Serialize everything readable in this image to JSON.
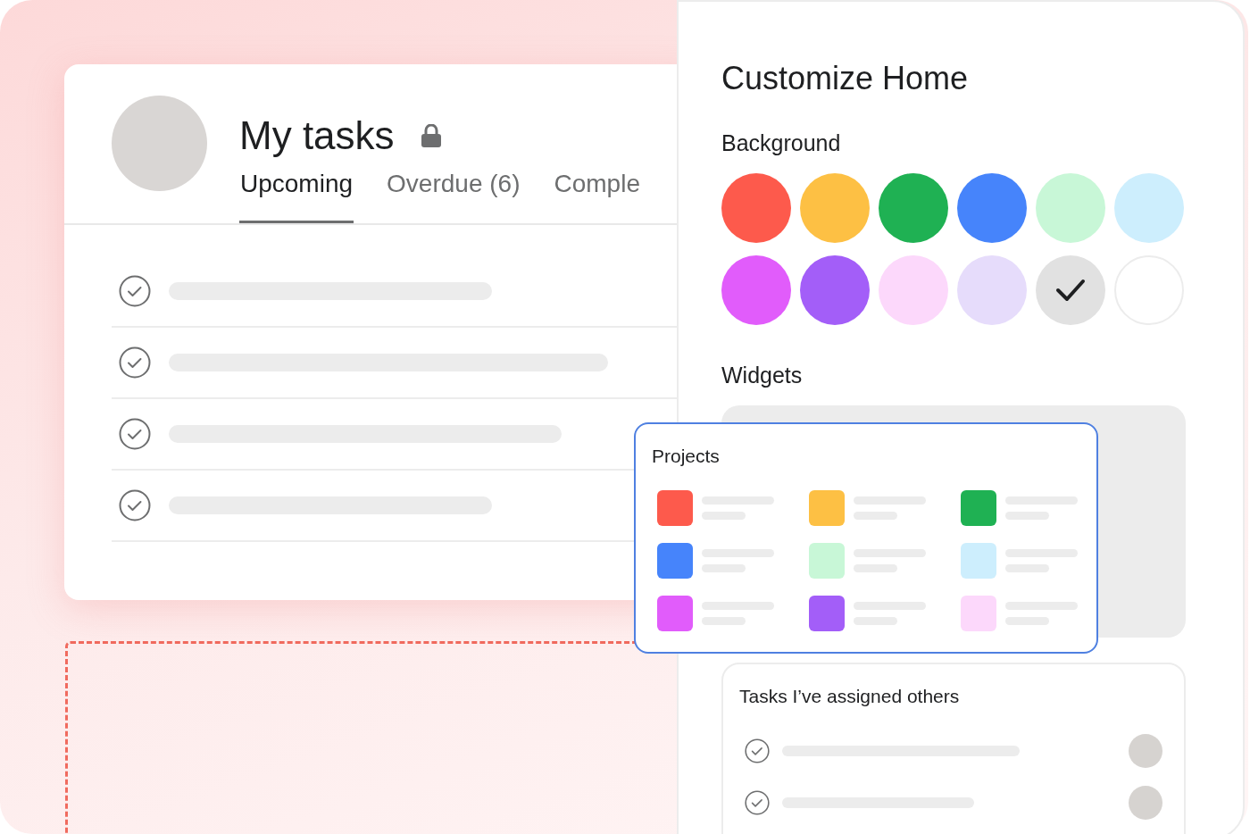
{
  "my_tasks": {
    "title": "My tasks",
    "locked": true,
    "tabs": [
      {
        "label": "Upcoming",
        "selected": true
      },
      {
        "label": "Overdue (6)",
        "selected": false
      },
      {
        "label": "Comple",
        "selected": false
      }
    ]
  },
  "customize": {
    "title": "Customize Home",
    "background": {
      "heading": "Background",
      "swatches": [
        {
          "color": "#fd5a4c",
          "selected": false
        },
        {
          "color": "#fdc044",
          "selected": false
        },
        {
          "color": "#1fb153",
          "selected": false
        },
        {
          "color": "#4684fb",
          "selected": false
        },
        {
          "color": "#c8f7d7",
          "selected": false
        },
        {
          "color": "#cdeefd",
          "selected": false
        },
        {
          "color": "#e15cfb",
          "selected": false
        },
        {
          "color": "#a35ef8",
          "selected": false
        },
        {
          "color": "#fcd8fb",
          "selected": false
        },
        {
          "color": "#e6dcfb",
          "selected": false
        },
        {
          "color": "#e1e1e1",
          "selected": true
        },
        {
          "color": "#ffffff",
          "selected": false
        }
      ]
    },
    "widgets": {
      "heading": "Widgets",
      "projects": {
        "title": "Projects",
        "items": [
          {
            "color": "#fd5a4c"
          },
          {
            "color": "#fdc044"
          },
          {
            "color": "#1fb153"
          },
          {
            "color": "#4684fb"
          },
          {
            "color": "#c8f7d7"
          },
          {
            "color": "#cdeefd"
          },
          {
            "color": "#e15cfb"
          },
          {
            "color": "#a35ef8"
          },
          {
            "color": "#fcd8fb"
          }
        ]
      },
      "assigned": {
        "title": "Tasks I’ve assigned others"
      }
    }
  }
}
